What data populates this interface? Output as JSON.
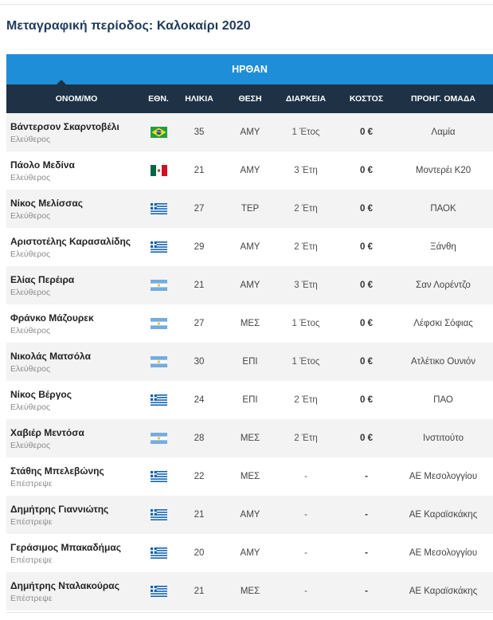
{
  "page": {
    "title": "Μεταγραφική περίοδος: Καλοκαίρι 2020"
  },
  "table": {
    "section_title": "ΗΡΘΑΝ",
    "headers": {
      "name": "ΟΝΟΜ/ΜΟ",
      "nat": "ΕΘΝ.",
      "age": "ΗΛΙΚΙΑ",
      "pos": "ΘΕΣΗ",
      "dur": "ΔΙΑΡΚΕΙΑ",
      "cost": "ΚΟΣΤΟΣ",
      "prev": "ΠΡΟΗΓ. ΟΜΑΔΑ"
    },
    "rows": [
      {
        "name": "Βάντερσον Σκαρντοβέλι",
        "status": "Ελεύθερος",
        "flag": "brazil",
        "age": "35",
        "pos": "ΑΜΥ",
        "dur": "1 Έτος",
        "cost": "0 €",
        "prev": "Λαμία"
      },
      {
        "name": "Πάολο Μεδίνα",
        "status": "Ελεύθερος",
        "flag": "mexico",
        "age": "21",
        "pos": "ΑΜΥ",
        "dur": "3 Έτη",
        "cost": "0 €",
        "prev": "Μοντερέι Κ20"
      },
      {
        "name": "Νίκος Μελίσσας",
        "status": "Ελεύθερος",
        "flag": "greece",
        "age": "27",
        "pos": "ΤΕΡ",
        "dur": "2 Έτη",
        "cost": "0 €",
        "prev": "ΠΑΟΚ"
      },
      {
        "name": "Αριστοτέλης Καρασαλίδης",
        "status": "Ελεύθερος",
        "flag": "greece",
        "age": "29",
        "pos": "ΑΜΥ",
        "dur": "2 Έτη",
        "cost": "0 €",
        "prev": "Ξάνθη"
      },
      {
        "name": "Ελίας Περέιρα",
        "status": "Ελεύθερος",
        "flag": "argentina",
        "age": "21",
        "pos": "ΑΜΥ",
        "dur": "3 Έτη",
        "cost": "0 €",
        "prev": "Σαν Λορέντζο"
      },
      {
        "name": "Φράνκο Μάζουρεκ",
        "status": "Ελεύθερος",
        "flag": "argentina",
        "age": "27",
        "pos": "ΜΕΣ",
        "dur": "1 Έτος",
        "cost": "0 €",
        "prev": "Λέφσκι Σόφιας"
      },
      {
        "name": "Νικολάς Ματσόλα",
        "status": "Ελεύθερος",
        "flag": "argentina",
        "age": "30",
        "pos": "ΕΠΙ",
        "dur": "1 Έτος",
        "cost": "0 €",
        "prev": "Ατλέτικο Ουνιόν"
      },
      {
        "name": "Νίκος Βέργος",
        "status": "Ελεύθερος",
        "flag": "greece",
        "age": "24",
        "pos": "ΕΠΙ",
        "dur": "2 Έτη",
        "cost": "0 €",
        "prev": "ΠΑΟ"
      },
      {
        "name": "Χαβιέρ Μεντόσα",
        "status": "Ελεύθερος",
        "flag": "argentina",
        "age": "28",
        "pos": "ΜΕΣ",
        "dur": "2 Έτη",
        "cost": "0 €",
        "prev": "Ινστιτούτο"
      },
      {
        "name": "Στάθης Μπελεβώνης",
        "status": "Επέστρεψε",
        "flag": "greece",
        "age": "22",
        "pos": "ΜΕΣ",
        "dur": "-",
        "cost": "-",
        "prev": "ΑΕ Μεσολογγίου"
      },
      {
        "name": "Δημήτρης Γιαννιώτης",
        "status": "Επέστρεψε",
        "flag": "greece",
        "age": "21",
        "pos": "ΑΜΥ",
        "dur": "-",
        "cost": "-",
        "prev": "ΑΕ Καραϊσκάκης"
      },
      {
        "name": "Γεράσιμος Μπακαδήμας",
        "status": "Επέστρεψε",
        "flag": "greece",
        "age": "20",
        "pos": "ΑΜΥ",
        "dur": "-",
        "cost": "-",
        "prev": "ΑΕ Μεσολογγίου"
      },
      {
        "name": "Δημήτρης Νταλακούρας",
        "status": "Επέστρεψε",
        "flag": "greece",
        "age": "21",
        "pos": "ΜΕΣ",
        "dur": "-",
        "cost": "-",
        "prev": "ΑΕ Καραϊσκάκης"
      }
    ]
  },
  "colors": {
    "banner": "#1f8ed8",
    "header": "#1e3145",
    "title": "#1f3a5a"
  }
}
